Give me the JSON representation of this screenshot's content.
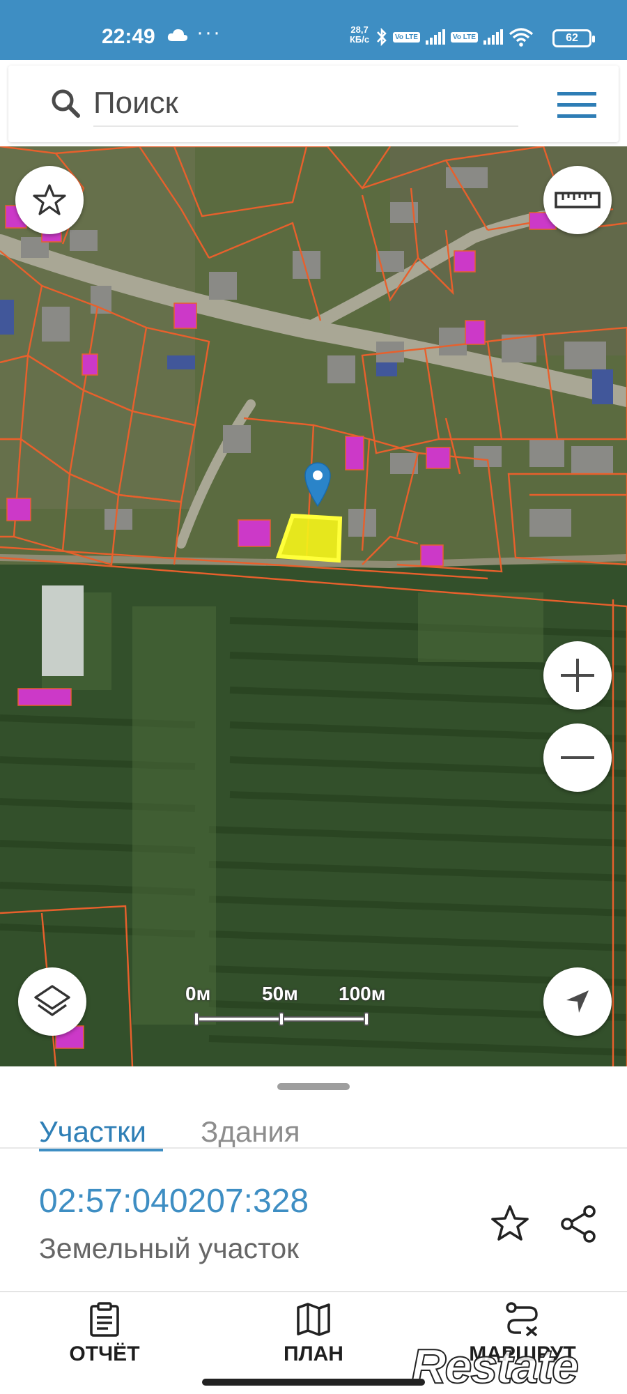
{
  "status_bar": {
    "time": "22:49",
    "dots": "···",
    "network_speed_value": "28,7",
    "network_speed_unit": "КБ/с",
    "volte_1": "Vo LTE",
    "volte_2": "Vo LTE",
    "battery": "62"
  },
  "search": {
    "placeholder": "Поиск"
  },
  "map": {
    "icons": [
      "star-icon",
      "ruler-icon",
      "zoom-in-icon",
      "zoom-out-icon",
      "layers-icon",
      "my-location-icon"
    ],
    "scale_labels": [
      "0м",
      "50м",
      "100м"
    ],
    "colors": {
      "parcel_border": "#e8602c",
      "selected_parcel": "#f5f51a",
      "building": "#cc39c8",
      "marker": "#2a84c9"
    }
  },
  "sheet": {
    "tabs": [
      {
        "label": "Участки",
        "active": true
      },
      {
        "label": "Здания",
        "active": false
      }
    ],
    "cadastral_number": "02:57:040207:328",
    "object_type": "Земельный участок"
  },
  "bottom_nav": {
    "items": [
      {
        "label": "ОТЧЁТ",
        "icon": "report-clipboard-icon"
      },
      {
        "label": "ПЛАН",
        "icon": "map-plan-icon"
      },
      {
        "label": "МАРШРУТ",
        "icon": "route-icon"
      }
    ]
  },
  "watermark": "Restate"
}
